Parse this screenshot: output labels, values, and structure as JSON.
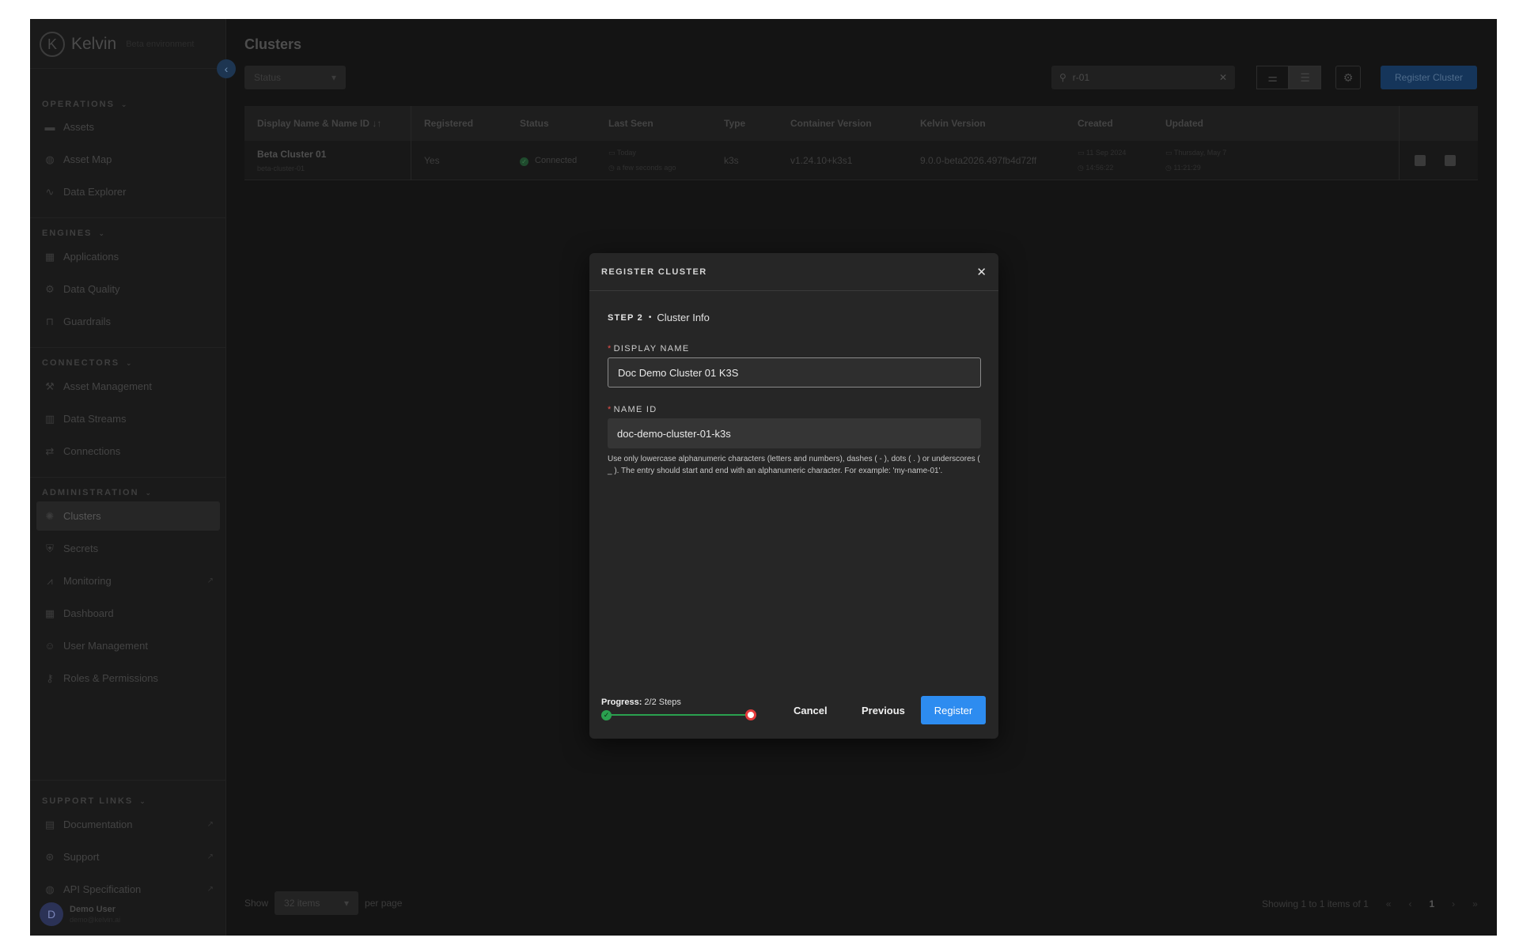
{
  "brand": {
    "name": "Kelvin",
    "subtitle": "Beta environment",
    "logo_letter": "K"
  },
  "sidebar": {
    "sections": {
      "operations": "OPERATIONS",
      "engines": "ENGINES",
      "connectors": "CONNECTORS",
      "administration": "ADMINISTRATION",
      "support": "SUPPORT LINKS"
    },
    "items": {
      "assets": "Assets",
      "asset_map": "Asset Map",
      "data_explorer": "Data Explorer",
      "applications": "Applications",
      "data_quality": "Data Quality",
      "guardrails": "Guardrails",
      "asset_management": "Asset Management",
      "data_streams": "Data Streams",
      "connections": "Connections",
      "clusters": "Clusters",
      "secrets": "Secrets",
      "monitoring": "Monitoring",
      "dashboard": "Dashboard",
      "user_management": "User Management",
      "roles_permissions": "Roles & Permissions",
      "documentation": "Documentation",
      "support": "Support",
      "api_specification": "API Specification"
    },
    "user": {
      "name": "Demo User",
      "email": "demo@kelvin.ai",
      "initial": "D"
    }
  },
  "main": {
    "title": "Clusters",
    "status_filter": "Status",
    "search": {
      "value": "r-01"
    },
    "register_button": "Register Cluster",
    "table": {
      "columns": [
        "Display Name & Name ID",
        "Registered",
        "Status",
        "Last Seen",
        "Type",
        "Container Version",
        "Kelvin Version",
        "Created",
        "Updated"
      ],
      "sort_indicator": "↓↑",
      "rows": [
        {
          "display_name": "Beta Cluster 01",
          "name_id": "beta-cluster-01",
          "registered": "Yes",
          "status": "Connected",
          "last_seen_date": "Today",
          "last_seen_time": "a few seconds ago",
          "type": "k3s",
          "container_version": "v1.24.10+k3s1",
          "kelvin_version": "9.0.0-beta2026.497fb4d72ff",
          "created_date": "11 Sep 2024",
          "created_time": "14:56:22",
          "updated_date": "Thursday, May 7",
          "updated_time": "11:21:29"
        }
      ]
    },
    "pagination": {
      "show_label": "Show",
      "per_page_value": "32 items",
      "per_page_label": "per page",
      "summary": "Showing 1 to 1 items of 1",
      "current_page": "1"
    }
  },
  "modal": {
    "title": "REGISTER CLUSTER",
    "step_label": "STEP 2",
    "step_name": "Cluster Info",
    "display_name": {
      "label": "DISPLAY NAME",
      "value": "Doc Demo Cluster 01 K3S"
    },
    "name_id": {
      "label": "NAME ID",
      "value": "doc-demo-cluster-01-k3s",
      "help": "Use only lowercase alphanumeric characters (letters and numbers), dashes ( - ), dots ( . ) or underscores ( _ ). The entry should start and end with an alphanumeric character. For example: 'my-name-01'."
    },
    "progress": {
      "label": "Progress:",
      "value": "2/2 Steps",
      "fraction": 1.0
    },
    "buttons": {
      "cancel": "Cancel",
      "previous": "Previous",
      "register": "Register"
    },
    "colors": {
      "primary": "#2d8cf0",
      "progress": "#2aa04f",
      "current_step": "#e43b3b"
    }
  }
}
